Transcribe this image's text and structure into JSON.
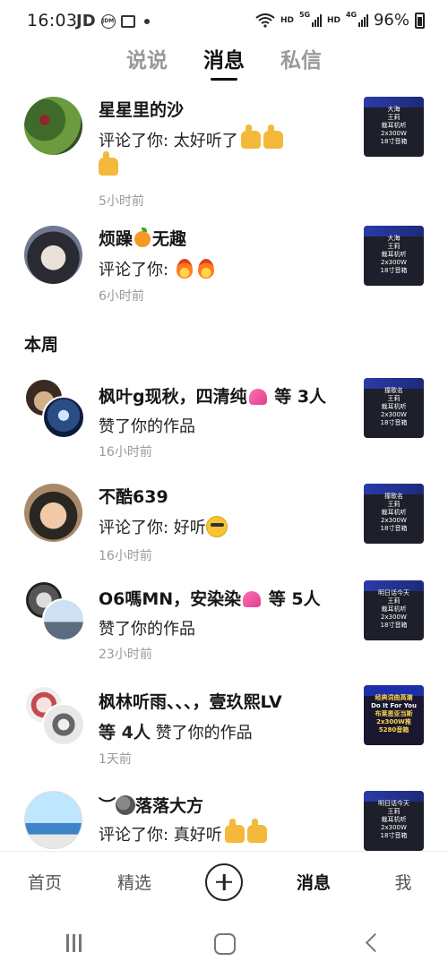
{
  "status_bar": {
    "time": "16:03",
    "left_text": "JD",
    "hd1": "HD",
    "net1": "5G",
    "hd2": "HD",
    "net2": "4G",
    "battery": "96%"
  },
  "tabs": [
    {
      "label": "说说",
      "active": false
    },
    {
      "label": "消息",
      "active": true
    },
    {
      "label": "私信",
      "active": false
    }
  ],
  "notifications": [
    {
      "name": "星星里的沙",
      "action": "评论了你: 太好听了",
      "time": "5小时前",
      "thumb": [
        "大海",
        "王莉",
        "裁耳机听",
        "2x300W",
        "18寸音箱"
      ]
    },
    {
      "name_a": "烦躁",
      "name_b": "无趣",
      "action": "评论了你: ",
      "time": "6小时前",
      "thumb": [
        "大海",
        "王莉",
        "裁耳机听",
        "2x300W",
        "18寸音箱"
      ]
    }
  ],
  "section_week": "本周",
  "week_items": [
    {
      "name": "枫叶g现秋，四清纯",
      "suffix": " 等 3人",
      "action": "赞了你的作品",
      "time": "16小时前",
      "thumb": [
        "撞歌名",
        "王莉",
        "裁耳机听",
        "2x300W",
        "18寸音箱"
      ]
    },
    {
      "name": "不酷639",
      "action": "评论了你: 好听",
      "time": "16小时前",
      "thumb": [
        "撞歌名",
        "王莉",
        "裁耳机听",
        "2x300W",
        "18寸音箱"
      ]
    },
    {
      "name": "O6嗎MN，安染染",
      "suffix": " 等 5人",
      "action": "赞了你的作品",
      "time": "23小时前",
      "thumb": [
        "明日话今天",
        "王莉",
        "裁耳机听",
        "2x300W",
        "18寸音箱"
      ]
    },
    {
      "name": "枫林听雨、、、，壹玖熙LV",
      "line2_bold": "等 4人",
      "action": " 赞了你的作品",
      "time": "1天前",
      "thumb": [
        "经典词曲高潮",
        "Do It For You",
        "布莱恩亚当斯",
        "2x300W推",
        "5280音箱"
      ]
    },
    {
      "name": "落落大方",
      "prefix": "︶",
      "action": "评论了你: 真好听",
      "thumb": [
        "明日话今天",
        "王莉",
        "裁耳机听",
        "2x300W",
        "18寸音箱"
      ]
    }
  ],
  "bottom_nav": [
    {
      "label": "首页"
    },
    {
      "label": "精选"
    },
    {
      "label": "消息"
    },
    {
      "label": "我"
    }
  ]
}
